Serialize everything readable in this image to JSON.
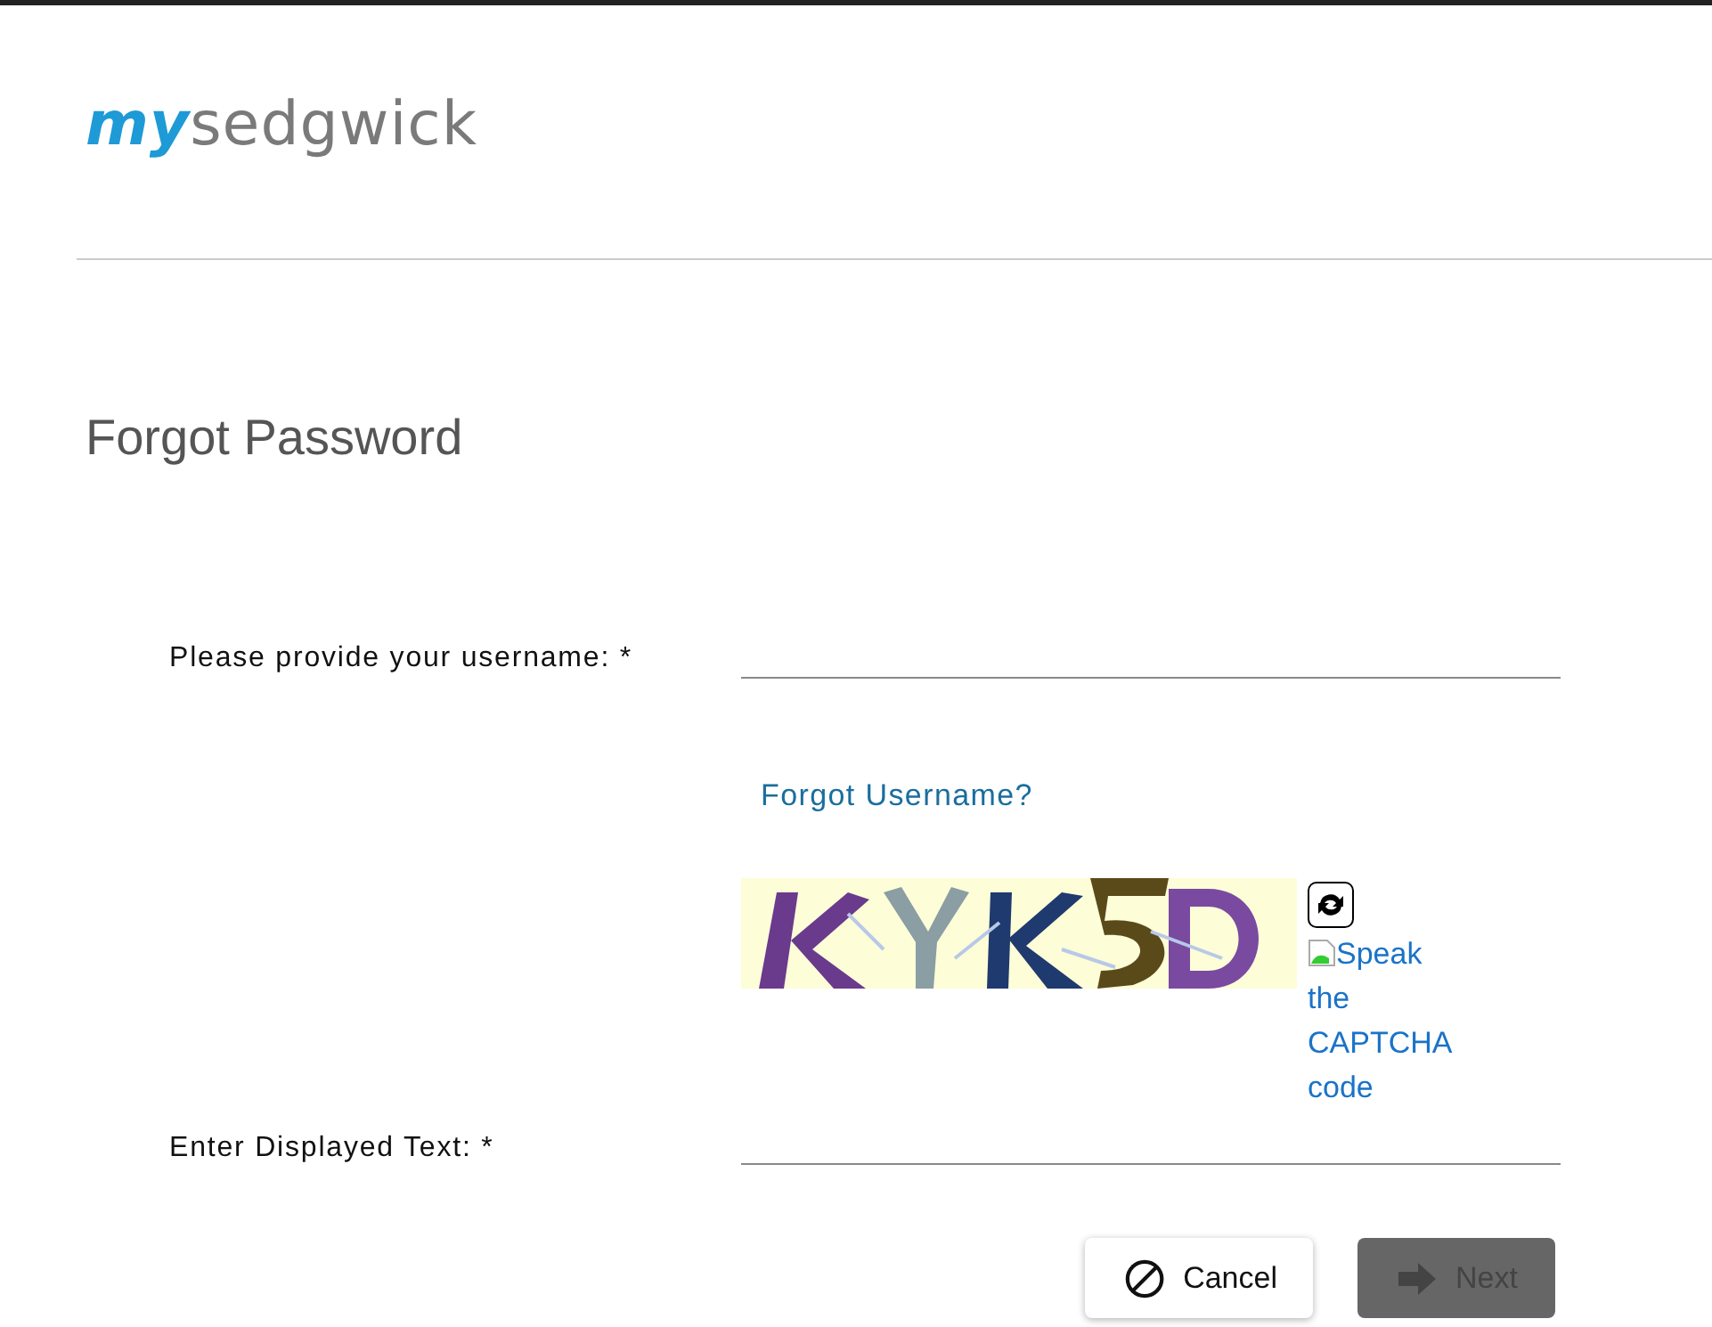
{
  "logo": {
    "prefix": "my",
    "name": "sedgwick"
  },
  "title": "Forgot Password",
  "fields": [
    {
      "kind": "text",
      "label": "Please provide your username: *",
      "link": "Forgot Username?"
    },
    {
      "kind": "captcha",
      "label": "Enter Displayed Text: *",
      "audio_link": "Speak the CAPTCHA code"
    }
  ],
  "buttons": [
    {
      "kind": "cancel",
      "label": "Cancel",
      "disabled": false
    },
    {
      "kind": "next",
      "label": "Next",
      "disabled": true
    }
  ]
}
